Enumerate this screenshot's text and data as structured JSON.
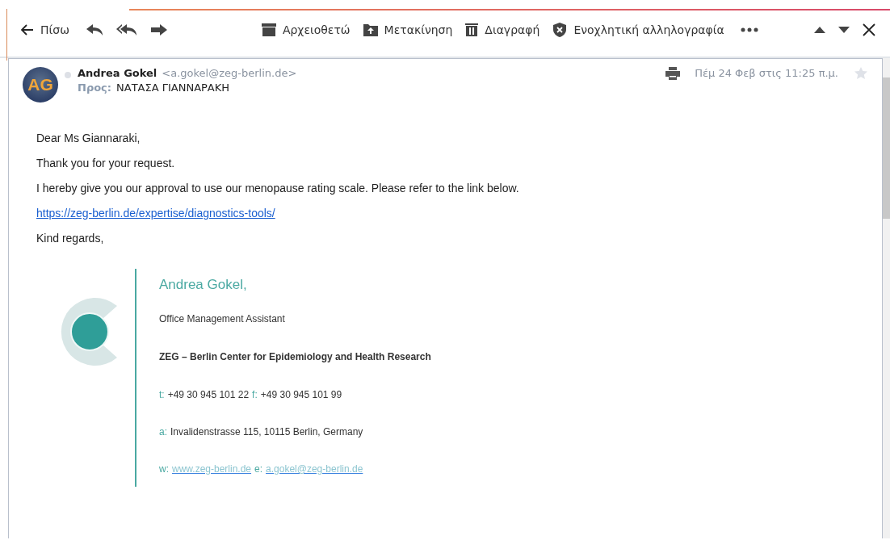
{
  "toolbar": {
    "back": "Πίσω",
    "actions": [
      {
        "kind": "archive",
        "label": "Αρχειοθετώ"
      },
      {
        "kind": "move",
        "label": "Μετακίνηση"
      },
      {
        "kind": "delete",
        "label": "Διαγραφή"
      },
      {
        "kind": "spam",
        "label": "Ενοχλητική αλληλογραφία"
      }
    ]
  },
  "message": {
    "avatar": "AG",
    "sender": "Andrea Gokel",
    "sender_email": "<a.gokel@zeg-berlin.de>",
    "to_label": "Προς:",
    "to": "ΝΑΤΑΣΑ ΓΙΑΝΝΑΡΑΚΗ",
    "date": "Πέμ 24 Φεβ στις 11:25 π.μ.",
    "starred": false,
    "body": [
      {
        "kind": "text",
        "text": "Dear Ms Giannaraki,"
      },
      {
        "kind": "text",
        "text": "Thank you for your request."
      },
      {
        "kind": "text",
        "text": "I hereby give you our approval to use our menopause rating scale. Please refer to the link below."
      },
      {
        "kind": "link",
        "text": "https://zeg-berlin.de/expertise/diagnostics-tools/"
      },
      {
        "kind": "text",
        "text": "Kind regards,"
      }
    ],
    "signature": {
      "name": "Andrea Gokel,",
      "title": "Office Management Assistant",
      "organization": "ZEG – Berlin Center for Epidemiology and Health Research",
      "contacts": [
        [
          {
            "label": "t:",
            "value": "+49 30 945 101 22",
            "kind": "text"
          },
          {
            "label": "f:",
            "value": "+49 30 945 101 99",
            "kind": "text"
          }
        ],
        [
          {
            "label": "a:",
            "value": "Invalidenstrasse 115, 10115 Berlin, Germany",
            "kind": "text"
          }
        ],
        [
          {
            "label": "w:",
            "value": "www.zeg-berlin.de",
            "kind": "link"
          },
          {
            "label": "e:",
            "value": "a.gokel@zeg-berlin.de",
            "kind": "link"
          }
        ]
      ]
    }
  }
}
